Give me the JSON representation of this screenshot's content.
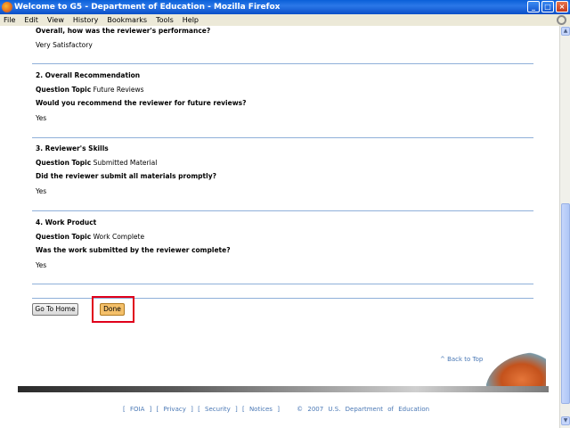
{
  "window": {
    "title": "Welcome to G5 - Department of Education - Mozilla Firefox",
    "buttons": {
      "minimize": "_",
      "maximize": "□",
      "close": "×"
    }
  },
  "menu": {
    "items": [
      "File",
      "Edit",
      "View",
      "History",
      "Bookmarks",
      "Tools",
      "Help"
    ]
  },
  "sections": [
    {
      "question": "Overall, how was the reviewer's performance?",
      "answer": "Very Satisfactory"
    },
    {
      "heading": "2. Overall Recommendation",
      "topic_label": "Question Topic",
      "topic": "Future Reviews",
      "question": "Would you recommend the reviewer for future reviews?",
      "answer": "Yes"
    },
    {
      "heading": "3. Reviewer's Skills",
      "topic_label": "Question Topic",
      "topic": "Submitted Material",
      "question": "Did the reviewer submit all materials promptly?",
      "answer": "Yes"
    },
    {
      "heading": "4. Work Product",
      "topic_label": "Question Topic",
      "topic": "Work Complete",
      "question": "Was the work submitted by the reviewer complete?",
      "answer": "Yes"
    }
  ],
  "actions": {
    "home_label": "Go To Home",
    "done_label": "Done"
  },
  "back_to_top": "^ Back to Top",
  "footer": {
    "links": [
      "FOIA",
      "Privacy",
      "Security",
      "Notices"
    ],
    "copyright": "© 2007 U.S. Department of Education"
  }
}
